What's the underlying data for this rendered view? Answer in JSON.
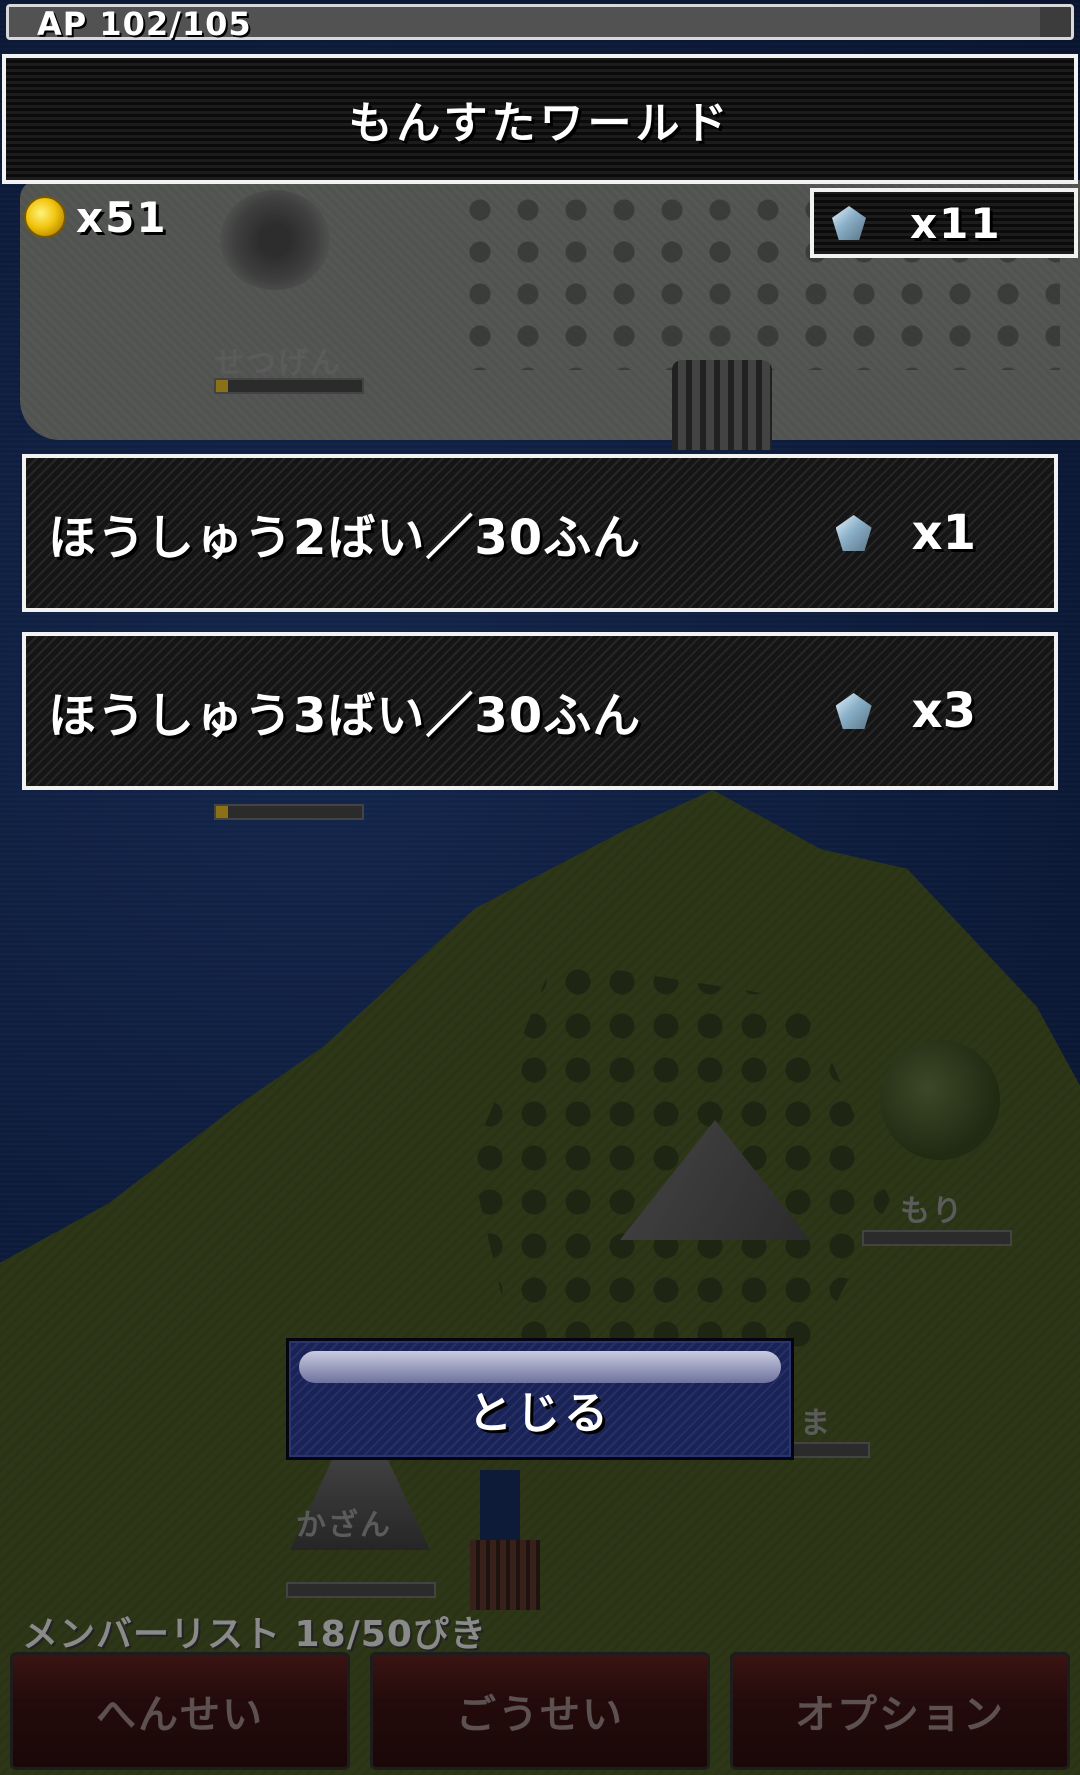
{
  "hud": {
    "ap_text": "AP 102/105",
    "ap_fraction": 0.971,
    "coin_count": "x51",
    "gem_count": "x11"
  },
  "title": "もんすたワールド",
  "options": [
    {
      "label": "ほうしゅう2ばい／30ふん",
      "cost": "x1"
    },
    {
      "label": "ほうしゅう3ばい／30ふん",
      "cost": "x3"
    }
  ],
  "close_label": "とじる",
  "map": {
    "places": [
      {
        "name": "せつげん",
        "progress": 0.08
      },
      {
        "name": "もり",
        "progress": 0.0
      },
      {
        "name": "ま",
        "progress": 0.0
      },
      {
        "name": "かざん",
        "progress": 0.0
      }
    ]
  },
  "footer": {
    "member_list": "メンバーリスト 18/50ぴき",
    "nav": [
      "へんせい",
      "ごうせい",
      "オプション"
    ]
  },
  "colors": {
    "panel_border": "#f2f2f2",
    "close_button": "#1a2358",
    "coin": "#f1c40f",
    "nav_button": "#240b0b"
  }
}
